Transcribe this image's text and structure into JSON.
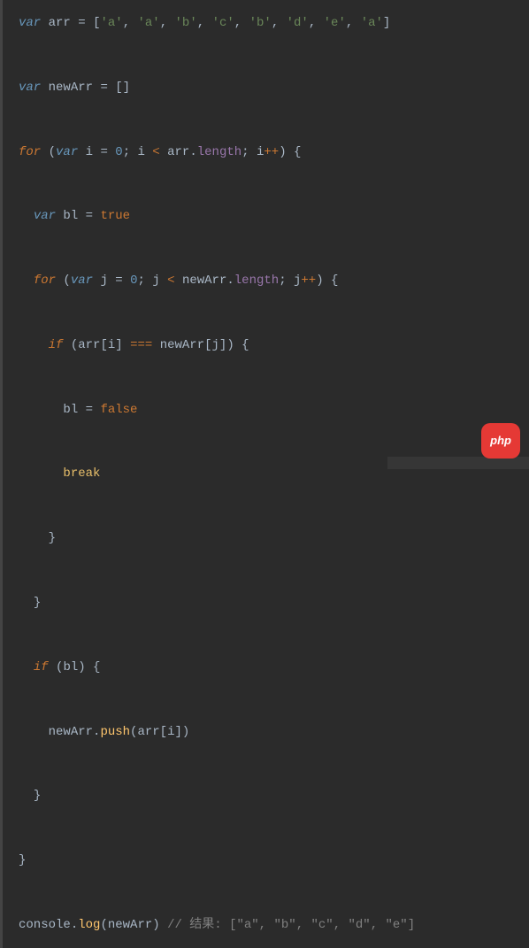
{
  "code": {
    "line1": {
      "var": "var",
      "arr": "arr",
      "eq": " = ",
      "br_o": "[",
      "s1": "'a'",
      "c": ", ",
      "s2": "'a'",
      "s3": "'b'",
      "s4": "'c'",
      "s5": "'b'",
      "s6": "'d'",
      "s7": "'e'",
      "s8": "'a'",
      "br_c": "]"
    },
    "line3": {
      "var": "var",
      "newArr": "newArr",
      "eq": " = ",
      "empty": "[]"
    },
    "line5": {
      "for": "for",
      "po": " (",
      "var": "var",
      "i": " i",
      "eq": " = ",
      "zero": "0",
      "semi": "; ",
      "i2": "i",
      "lt": " < ",
      "arr": "arr",
      "dot": ".",
      "length": "length",
      "semi2": "; ",
      "i3": "i",
      "inc": "++",
      "pc": ") {"
    },
    "line7": {
      "var": "var",
      "bl": " bl",
      "eq": " = ",
      "true": "true"
    },
    "line9": {
      "for": "for",
      "po": " (",
      "var": "var",
      "j": " j",
      "eq": " = ",
      "zero": "0",
      "semi": "; ",
      "j2": "j",
      "lt": " < ",
      "newArr": "newArr",
      "dot": ".",
      "length": "length",
      "semi2": "; ",
      "j3": "j",
      "inc": "++",
      "pc": ") {"
    },
    "line11": {
      "if": "if",
      "po": " (",
      "arr": "arr",
      "bo": "[",
      "i": "i",
      "bc": "]",
      "eq3": " === ",
      "newArr": "newArr",
      "bo2": "[",
      "j": "j",
      "bc2": "]",
      "pc": ") {"
    },
    "line13": {
      "bl": "bl",
      "eq": " = ",
      "false": "false"
    },
    "line15": {
      "break": "break"
    },
    "line17": {
      "close": "}"
    },
    "line19": {
      "close": "}"
    },
    "line21": {
      "if": "if",
      "po": " (",
      "bl": "bl",
      "pc": ") {"
    },
    "line23": {
      "newArr": "newArr",
      "dot": ".",
      "push": "push",
      "po": "(",
      "arr": "arr",
      "bo": "[",
      "i": "i",
      "bc": "]",
      "pc": ")"
    },
    "line25": {
      "close": "}"
    },
    "line27": {
      "close": "}"
    },
    "line29": {
      "console": "console",
      "dot": ".",
      "log": "log",
      "po": "(",
      "newArr": "newArr",
      "pc": ")",
      "comment": " // 结果: [\"a\", \"b\", \"c\", \"d\", \"e\"]"
    }
  },
  "watermark": {
    "label": "php"
  }
}
